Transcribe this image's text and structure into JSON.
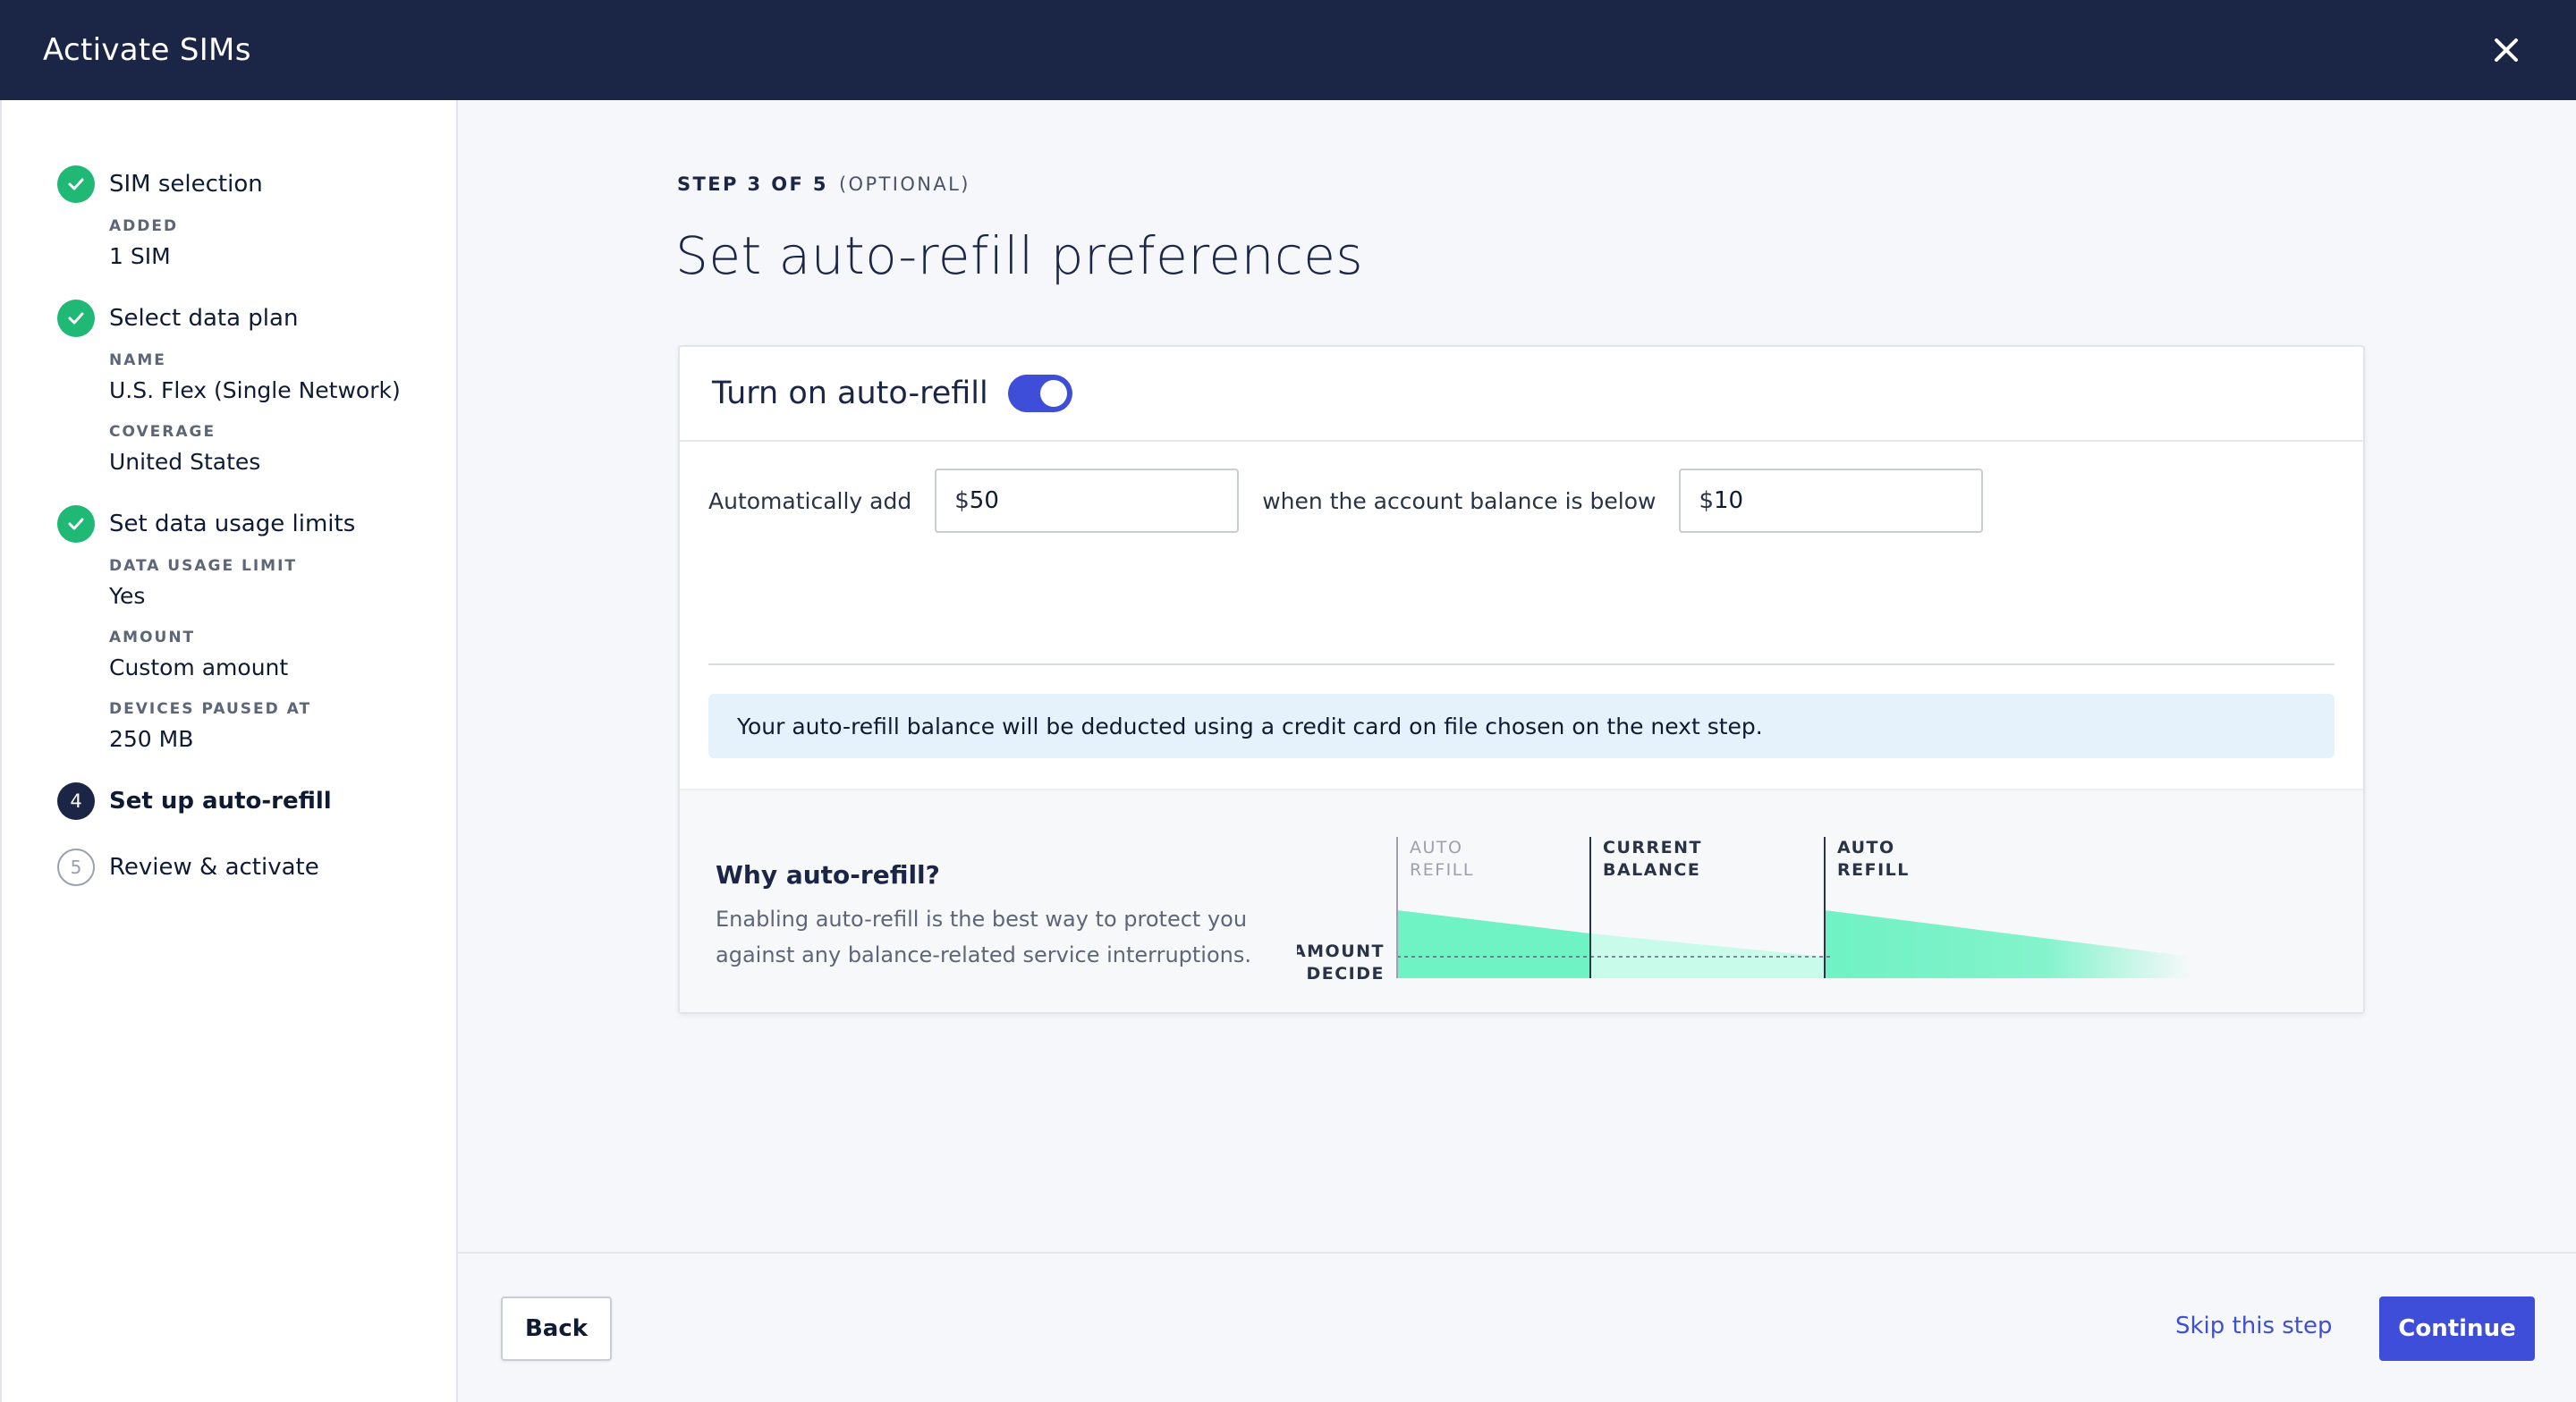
{
  "header": {
    "title": "Activate SIMs"
  },
  "sidebar": {
    "steps": [
      {
        "title": "SIM selection",
        "state": "done",
        "meta": [
          {
            "label": "ADDED",
            "value": "1 SIM"
          }
        ]
      },
      {
        "title": "Select data plan",
        "state": "done",
        "meta": [
          {
            "label": "NAME",
            "value": "U.S. Flex (Single Network)"
          },
          {
            "label": "COVERAGE",
            "value": "United States"
          }
        ]
      },
      {
        "title": "Set data usage limits",
        "state": "done",
        "meta": [
          {
            "label": "DATA USAGE LIMIT",
            "value": "Yes"
          },
          {
            "label": "AMOUNT",
            "value": "Custom amount"
          },
          {
            "label": "DEVICES PAUSED AT",
            "value": "250 MB"
          }
        ]
      },
      {
        "title": "Set up auto-refill",
        "state": "current",
        "number": "4"
      },
      {
        "title": "Review & activate",
        "state": "future",
        "number": "5"
      }
    ]
  },
  "main": {
    "eyebrow": "STEP 3 OF 5",
    "eyebrow_optional": "(OPTIONAL)",
    "title": "Set auto-refill preferences",
    "card": {
      "title": "Turn on auto-refill",
      "toggle_on": true,
      "auto_add_label": "Automatically add",
      "auto_add_prefix": "$",
      "auto_add_value": "50",
      "threshold_label": "when the account balance is below",
      "threshold_prefix": "$",
      "threshold_value": "10",
      "info": "Your auto-refill balance will be deducted using a credit card on file chosen on the next step.",
      "why_title": "Why auto-refill?",
      "why_text": "Enabling auto-refill is the best way to protect you against any balance-related service interruptions.",
      "diagram": {
        "label_1a": "AUTO",
        "label_1b": "REFILL",
        "label_2a": "CURRENT",
        "label_2b": "BALANCE",
        "label_3a": "AUTO",
        "label_3b": "REFILL",
        "axis_a": "$ AMOUNT",
        "axis_b": "YOU DECIDE"
      }
    }
  },
  "footer": {
    "back": "Back",
    "skip": "Skip this step",
    "continue": "Continue"
  },
  "colors": {
    "header_bg": "#1b2545",
    "accent": "#3e4ed8",
    "success": "#1fb874",
    "chart_green": "#6ff2c4"
  }
}
